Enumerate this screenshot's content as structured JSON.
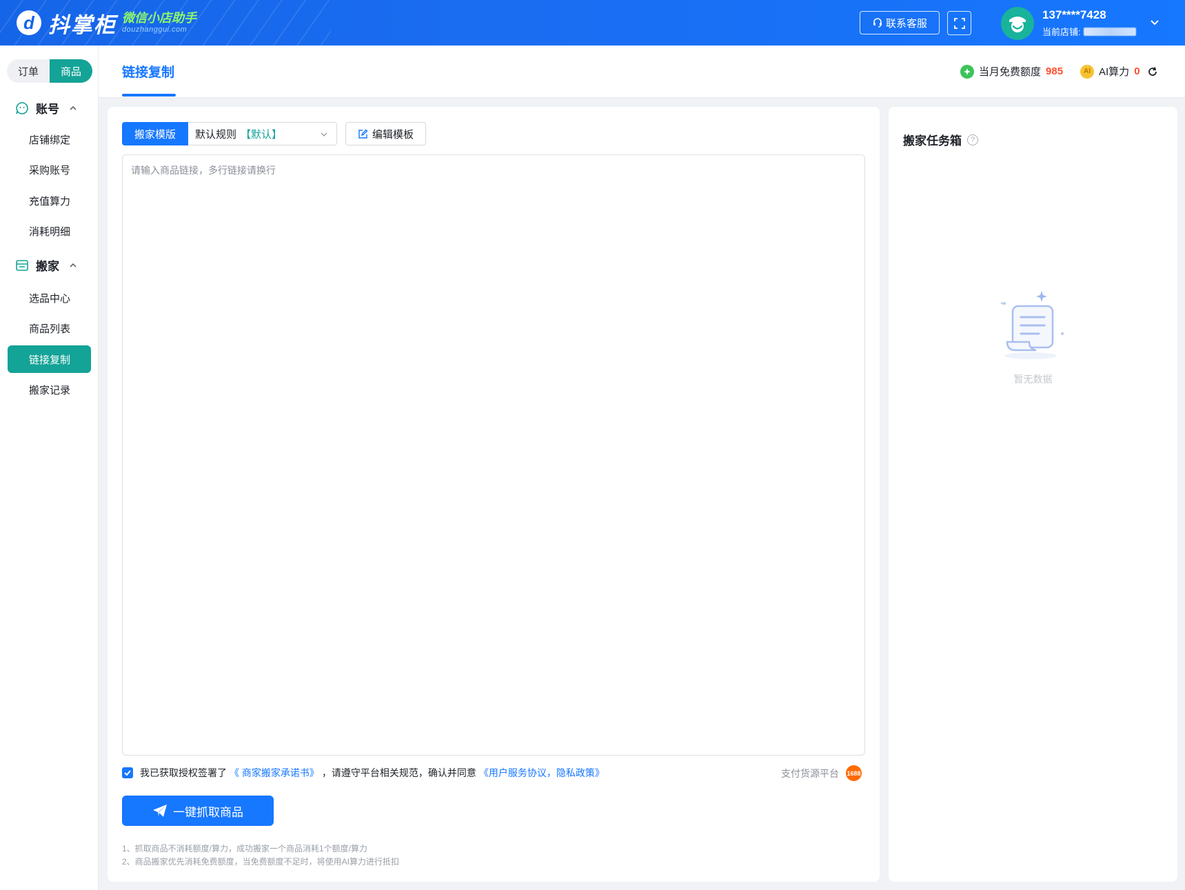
{
  "header": {
    "logo_mark": "d",
    "logo_name": "抖掌柜",
    "logo_sub_cn": "微信小店助手",
    "logo_sub_en": "douzhanggui.com",
    "support_label": "联系客服",
    "user_phone": "137****7428",
    "shop_label": "当前店铺:"
  },
  "sidebar": {
    "segments": [
      "订单",
      "商品"
    ],
    "active_segment": "商品",
    "groups": [
      {
        "label": "账号",
        "items": [
          "店铺绑定",
          "采购账号",
          "充值算力",
          "消耗明细"
        ]
      },
      {
        "label": "搬家",
        "items": [
          "选品中心",
          "商品列表",
          "链接复制",
          "搬家记录"
        ]
      }
    ],
    "active_item": "链接复制"
  },
  "tabbar": {
    "page_title": "链接复制",
    "free_quota_label": "当月免费额度",
    "free_quota_value": "985",
    "ai_label": "AI算力",
    "ai_value": "0"
  },
  "main": {
    "template_label": "搬家模版",
    "template_value": "默认规则",
    "template_tag": "【默认】",
    "edit_template_label": "编辑模板",
    "input_placeholder": "请输入商品链接，多行链接请换行",
    "agree_text_1": "我已获取授权签署了",
    "agree_link_1": "《 商家搬家承诺书》",
    "agree_text_2": "，请遵守平台相关规范，确认并同意",
    "agree_link_2": "《用户服务协议，隐私政策》",
    "pay_platform_label": "支付货源平台",
    "pay_logo_text": "1688",
    "grab_button_label": "一键抓取商品",
    "notes": [
      "1、抓取商品不消耗额度/算力，成功搬家一个商品消耗1个额度/算力",
      "2、商品搬家优先消耗免费额度，当免费额度不足时，将使用AI算力进行抵扣"
    ]
  },
  "task_box": {
    "title": "搬家任务箱",
    "empty_text": "暂无数据"
  },
  "colors": {
    "header_blue": "#1677ff",
    "teal_active": "#14a397",
    "link_blue": "#1677ff",
    "number_red": "#ff4d2e"
  },
  "icons": [
    "support-headset-icon",
    "fullscreen-icon",
    "chevron-down-icon",
    "account-group-icon",
    "move-group-icon",
    "caret-up-icon",
    "free-quota-coin-icon",
    "ai-coin-icon",
    "refresh-icon",
    "edit-icon",
    "dropdown-arrow-icon",
    "checkbox-checked-icon",
    "paper-plane-icon",
    "help-icon",
    "empty-scroll-icon"
  ]
}
